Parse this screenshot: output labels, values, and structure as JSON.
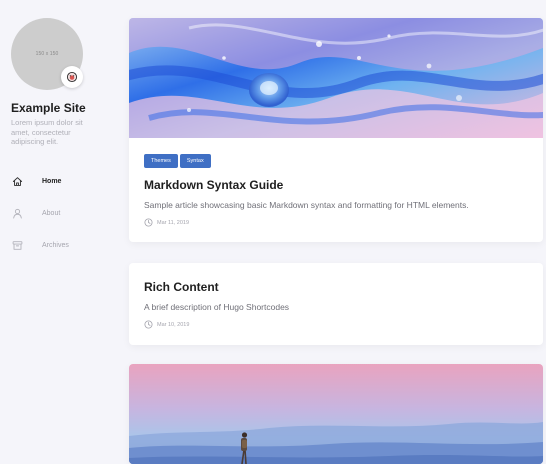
{
  "site": {
    "avatar_placeholder": "150 x 150",
    "title": "Example Site",
    "description": "Lorem ipsum dolor sit amet, consectetur adipiscing elit."
  },
  "menu": [
    {
      "label": "Home",
      "icon": "home-icon",
      "active": true
    },
    {
      "label": "About",
      "icon": "user-icon",
      "active": false
    },
    {
      "label": "Archives",
      "icon": "archive-icon",
      "active": false
    }
  ],
  "articles": [
    {
      "tags": [
        "Themes",
        "Syntax"
      ],
      "title": "Markdown Syntax Guide",
      "description": "Sample article showcasing basic Markdown syntax and formatting for HTML elements.",
      "date": "Mar 11, 2019"
    },
    {
      "title": "Rich Content",
      "description": "A brief description of Hugo Shortcodes",
      "date": "Mar 10, 2019"
    }
  ],
  "colors": {
    "background": "#f5f5fa",
    "accent": "#3f6fc4",
    "card": "#ffffff",
    "muted_text": "#a5a5ae"
  }
}
